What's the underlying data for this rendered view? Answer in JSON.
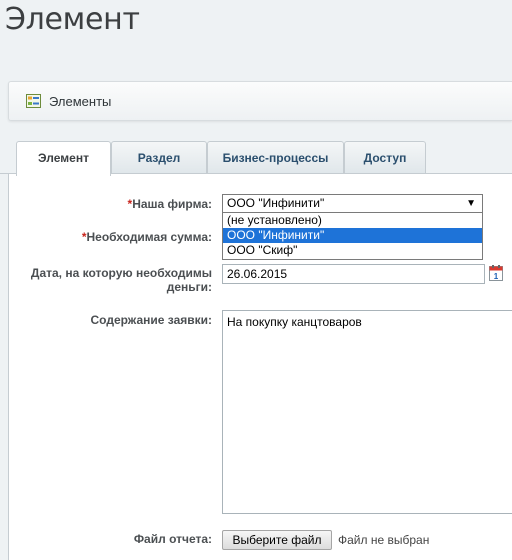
{
  "page": {
    "title": "Элемент"
  },
  "toolbar": {
    "label": "Элементы",
    "icon": "list-icon"
  },
  "tabs": [
    {
      "label": "Элемент",
      "active": true
    },
    {
      "label": "Раздел",
      "active": false
    },
    {
      "label": "Бизнес-процессы",
      "active": false
    },
    {
      "label": "Доступ",
      "active": false
    }
  ],
  "form": {
    "required_mark": "*",
    "firm": {
      "label": "Наша фирма:",
      "value": "ООО \"Инфинити\"",
      "options": [
        {
          "label": "(не установлено)",
          "selected": false
        },
        {
          "label": "ООО \"Инфинити\"",
          "selected": true
        },
        {
          "label": "ООО \"Скиф\"",
          "selected": false
        }
      ]
    },
    "amount": {
      "label": "Необходимая сумма:"
    },
    "date": {
      "label_line1": "Дата, на которую необходимы",
      "label_line2": "деньги:",
      "value": "26.06.2015"
    },
    "content": {
      "label": "Содержание заявки:",
      "value": "На покупку канцтоваров"
    },
    "file": {
      "label": "Файл отчета:",
      "button": "Выберите файл",
      "status": "Файл не выбран"
    }
  },
  "colors": {
    "accent": "#1e73d8",
    "required": "#c8241c",
    "tab_text": "#2b4f6e"
  }
}
